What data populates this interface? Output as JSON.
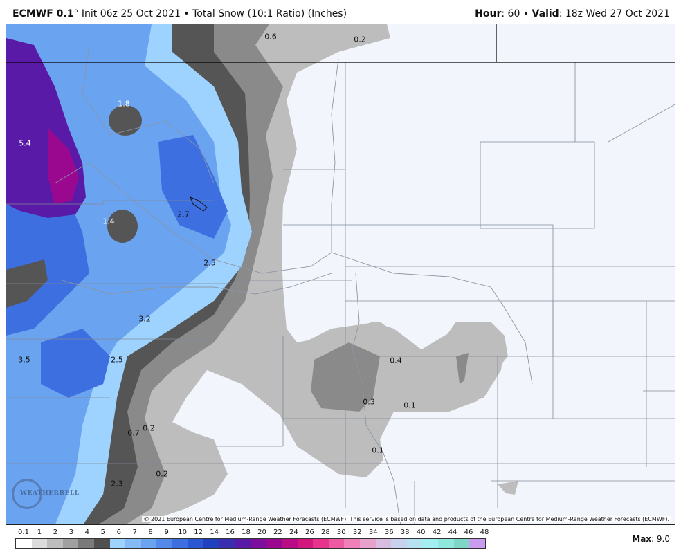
{
  "header": {
    "model": "ECMWF 0.1",
    "degree": "°",
    "init": "Init 06z 25 Oct 2021",
    "bullet": "•",
    "product": "Total Snow (10:1 Ratio) (Inches)",
    "hour_label": "Hour",
    "hour_value": ": 60",
    "valid_label": "Valid",
    "valid_value": ": 18z Wed 27 Oct 2021"
  },
  "map": {
    "labels": [
      {
        "text": "0.6",
        "tone": "dark"
      },
      {
        "text": "0.2",
        "tone": "dark"
      },
      {
        "text": "1.8",
        "tone": "light"
      },
      {
        "text": "5.4",
        "tone": "light"
      },
      {
        "text": "2.7",
        "tone": "dark"
      },
      {
        "text": "1.4",
        "tone": "light"
      },
      {
        "text": "2.5",
        "tone": "dark"
      },
      {
        "text": "3.2",
        "tone": "dark"
      },
      {
        "text": "3.5",
        "tone": "dark"
      },
      {
        "text": "2.5",
        "tone": "dark"
      },
      {
        "text": "0.4",
        "tone": "dark"
      },
      {
        "text": "0.3",
        "tone": "dark"
      },
      {
        "text": "0.1",
        "tone": "dark"
      },
      {
        "text": "0.2",
        "tone": "dark"
      },
      {
        "text": "0.7",
        "tone": "dark"
      },
      {
        "text": "0.1",
        "tone": "dark"
      },
      {
        "text": "0.2",
        "tone": "dark"
      },
      {
        "text": "2.3",
        "tone": "dark"
      }
    ],
    "copyright": "© 2021 European Centre for Medium-Range Weather Forecasts (ECMWF). This service is based on data and products of the European Centre for Medium-Range Weather Forecasts (ECMWF).",
    "logo_text": "WEATHERBELL"
  },
  "legend": {
    "labels": [
      "0.1",
      "1",
      "2",
      "3",
      "4",
      "5",
      "6",
      "7",
      "8",
      "9",
      "10",
      "12",
      "14",
      "16",
      "18",
      "20",
      "22",
      "24",
      "26",
      "28",
      "30",
      "32",
      "34",
      "36",
      "38",
      "40",
      "42",
      "44",
      "46",
      "48"
    ],
    "colors": [
      "#ffffff",
      "#dcdcdc",
      "#bdbdbd",
      "#a0a0a0",
      "#7a7a7a",
      "#505050",
      "#9fd3ff",
      "#84baf5",
      "#6aa3f0",
      "#5489ea",
      "#3e6fe0",
      "#2b57d4",
      "#2040bd",
      "#3b2db0",
      "#5a1aa8",
      "#7d0e9e",
      "#9b0890",
      "#b90c86",
      "#d4177e",
      "#e8338c",
      "#ee5aa2",
      "#f080b8",
      "#e7a2cc",
      "#d8bde0",
      "#c8d2ee",
      "#b5e1f2",
      "#a2eef0",
      "#8ee8dd",
      "#7fd6c6",
      "#c99cf0"
    ],
    "max_label": "Max",
    "max_value": ": 9.0"
  }
}
